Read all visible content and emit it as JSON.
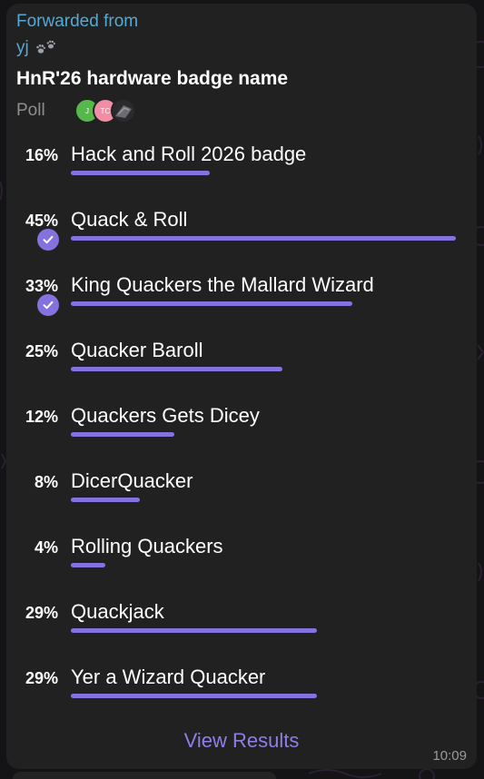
{
  "message": {
    "forwarded_label": "Forwarded from",
    "forwarded_from": "yj",
    "forwarded_icon": "paw-prints-icon",
    "title": "HnR'26 hardware badge name",
    "poll_type": "Poll",
    "voter_avatars": [
      {
        "initials": "J",
        "color": "#56b84a"
      },
      {
        "initials": "TC",
        "color": "#f08ea6"
      },
      {
        "initials": "",
        "color": "#2b2b2e"
      }
    ],
    "view_results_label": "View Results",
    "time": "10:09"
  },
  "poll": {
    "options": [
      {
        "percent_label": "16%",
        "text": "Hack and Roll 2026 badge",
        "fraction": 0.36,
        "chosen": false
      },
      {
        "percent_label": "45%",
        "text": "Quack & Roll",
        "fraction": 1.0,
        "chosen": true
      },
      {
        "percent_label": "33%",
        "text": "King Quackers the Mallard Wizard",
        "fraction": 0.73,
        "chosen": true
      },
      {
        "percent_label": "25%",
        "text": "Quacker Baroll",
        "fraction": 0.55,
        "chosen": false
      },
      {
        "percent_label": "12%",
        "text": "Quackers Gets Dicey",
        "fraction": 0.27,
        "chosen": false
      },
      {
        "percent_label": "8%",
        "text": "DicerQuacker",
        "fraction": 0.18,
        "chosen": false
      },
      {
        "percent_label": "4%",
        "text": "Rolling Quackers",
        "fraction": 0.09,
        "chosen": false
      },
      {
        "percent_label": "29%",
        "text": "Quackjack",
        "fraction": 0.64,
        "chosen": false
      },
      {
        "percent_label": "29%",
        "text": "Yer a Wizard Quacker",
        "fraction": 0.64,
        "chosen": false
      }
    ]
  },
  "colors": {
    "accent": "#8672df",
    "link": "#56a9d3",
    "bubble": "#212121",
    "background": "#141416"
  }
}
